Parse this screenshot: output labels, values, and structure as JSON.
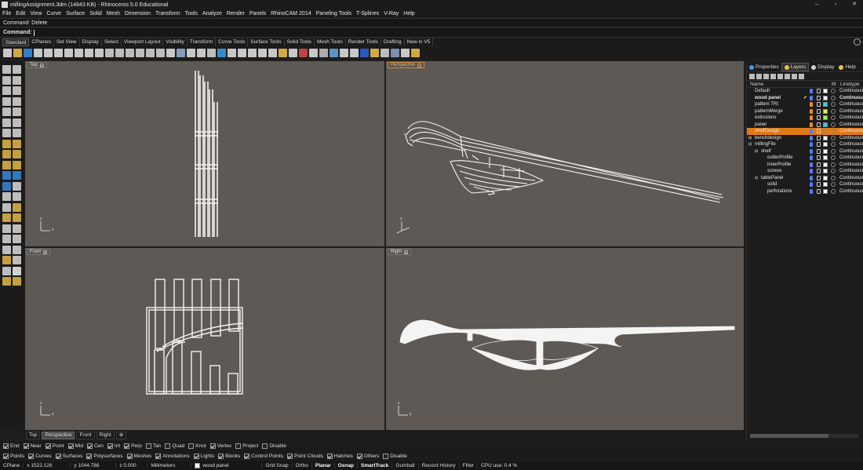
{
  "window": {
    "title": "millingAssignment.3dm (14843 KB) - Rhinoceros 5.0 Educational",
    "minimize": "–",
    "maximize": "▫",
    "close": "✕"
  },
  "menu": [
    "File",
    "Edit",
    "View",
    "Curve",
    "Surface",
    "Solid",
    "Mesh",
    "Dimension",
    "Transform",
    "Tools",
    "Analyze",
    "Render",
    "Panels",
    "RhinoCAM 2014",
    "Paneling Tools",
    "T-Splines",
    "V-Ray",
    "Help"
  ],
  "command": {
    "history": "Command: Delete",
    "prompt": "Command:"
  },
  "toolbar_tabs": [
    "Standard",
    "CPlanes",
    "Set View",
    "Display",
    "Select",
    "Viewport Layout",
    "Visibility",
    "Transform",
    "Curve Tools",
    "Surface Tools",
    "Solid Tools",
    "Mesh Tools",
    "Render Tools",
    "Drafting",
    "New in V5"
  ],
  "toolbar_tab_active": "Standard",
  "colors": {
    "viewport_bg": "#5e5954",
    "accent": "#e07a16",
    "active_viewport_label": "#f3b26a"
  },
  "viewports": {
    "top": {
      "label": "Top"
    },
    "perspective": {
      "label": "Perspective"
    },
    "front": {
      "label": "Front"
    },
    "right": {
      "label": "Right"
    }
  },
  "axes": {
    "x": "x",
    "y": "y",
    "z": "z"
  },
  "viewport_tabs": [
    "Top",
    "Perspective",
    "Front",
    "Right"
  ],
  "viewport_tab_active": "Perspective",
  "viewport_tab_add": "⊕",
  "panel": {
    "tabs": [
      {
        "label": "Properties",
        "icon": "properties-icon"
      },
      {
        "label": "Layers",
        "icon": "layers-icon"
      },
      {
        "label": "Display",
        "icon": "display-icon"
      },
      {
        "label": "Help",
        "icon": "help-icon"
      }
    ],
    "active_tab": "Layers",
    "columns": {
      "name": "Name",
      "material": "M",
      "linetype": "Linetype"
    },
    "layers": [
      {
        "name": "Default",
        "indent": 0,
        "color": "#ffffff",
        "linetype": "Continuous",
        "bulb": "#5b7bff",
        "current": false,
        "selected": false
      },
      {
        "name": "wood panel",
        "indent": 0,
        "color": "#ffffff",
        "linetype": "Continuous",
        "bulb": "#5b7bff",
        "current": true,
        "selected": false,
        "bold": true
      },
      {
        "name": "pattern TRI",
        "indent": 0,
        "color": "#22d3ee",
        "linetype": "Continuous",
        "bulb": "#ff8c1a",
        "current": false,
        "selected": false
      },
      {
        "name": "patternMerge",
        "indent": 0,
        "color": "#f5ec4a",
        "linetype": "Continuous",
        "bulb": "#ff8c1a",
        "current": false,
        "selected": false
      },
      {
        "name": "extrusions",
        "indent": 0,
        "color": "#9ef04b",
        "linetype": "Continuous",
        "bulb": "#ff8c1a",
        "current": false,
        "selected": false
      },
      {
        "name": "panel",
        "indent": 0,
        "color": "#22d3ee",
        "linetype": "Continuous",
        "bulb": "#ff8c1a",
        "current": false,
        "selected": false
      },
      {
        "name": "shelfDesign",
        "indent": 0,
        "color": "#e07a16",
        "linetype": "Continuous",
        "bulb": "#5b7bff",
        "current": false,
        "selected": true
      },
      {
        "name": "benchdesign",
        "indent": 0,
        "color": "#ffffff",
        "linetype": "Continuous",
        "bulb": "#5b7bff",
        "current": false,
        "selected": false,
        "expander": "⊞"
      },
      {
        "name": "millingFile",
        "indent": 0,
        "color": "#ffffff",
        "linetype": "Continuous",
        "bulb": "#5b7bff",
        "current": false,
        "selected": false,
        "expander": "⊟"
      },
      {
        "name": "shelf",
        "indent": 1,
        "color": "#ffffff",
        "linetype": "Continuous",
        "bulb": "#5b7bff",
        "current": false,
        "selected": false,
        "expander": "⊟"
      },
      {
        "name": "outterProfile",
        "indent": 2,
        "color": "#ffffff",
        "linetype": "Continuous",
        "bulb": "#5b7bff",
        "current": false,
        "selected": false
      },
      {
        "name": "innerProfile",
        "indent": 2,
        "color": "#ffffff",
        "linetype": "Continuous",
        "bulb": "#5b7bff",
        "current": false,
        "selected": false
      },
      {
        "name": "screws",
        "indent": 2,
        "color": "#ffffff",
        "linetype": "Continuous",
        "bulb": "#5b7bff",
        "current": false,
        "selected": false
      },
      {
        "name": "tablePanel",
        "indent": 1,
        "color": "#ffffff",
        "linetype": "Continuous",
        "bulb": "#5b7bff",
        "current": false,
        "selected": false,
        "expander": "⊟"
      },
      {
        "name": "solid",
        "indent": 2,
        "color": "#ffffff",
        "linetype": "Continuous",
        "bulb": "#5b7bff",
        "current": false,
        "selected": false
      },
      {
        "name": "perforations",
        "indent": 2,
        "color": "#ffffff",
        "linetype": "Continuous",
        "bulb": "#5b7bff",
        "current": false,
        "selected": false
      }
    ]
  },
  "osnaps": {
    "row1": [
      {
        "label": "End",
        "checked": true
      },
      {
        "label": "Near",
        "checked": true
      },
      {
        "label": "Point",
        "checked": true
      },
      {
        "label": "Mid",
        "checked": true
      },
      {
        "label": "Cen",
        "checked": true
      },
      {
        "label": "Int",
        "checked": true
      },
      {
        "label": "Perp",
        "checked": true
      },
      {
        "label": "Tan",
        "checked": false
      },
      {
        "label": "Quad",
        "checked": false
      },
      {
        "label": "Knot",
        "checked": false
      },
      {
        "label": "Vertex",
        "checked": true
      },
      {
        "label": "Project",
        "checked": false
      },
      {
        "label": "Disable",
        "checked": false
      }
    ],
    "row2": [
      {
        "label": "Points",
        "checked": true
      },
      {
        "label": "Curves",
        "checked": true
      },
      {
        "label": "Surfaces",
        "checked": true
      },
      {
        "label": "Polysurfaces",
        "checked": true
      },
      {
        "label": "Meshes",
        "checked": true
      },
      {
        "label": "Annotations",
        "checked": true
      },
      {
        "label": "Lights",
        "checked": true
      },
      {
        "label": "Blocks",
        "checked": true
      },
      {
        "label": "Control Points",
        "checked": true
      },
      {
        "label": "Point Clouds",
        "checked": true
      },
      {
        "label": "Hatches",
        "checked": true
      },
      {
        "label": "Others",
        "checked": true
      },
      {
        "label": "Disable",
        "checked": false
      }
    ]
  },
  "status": {
    "cplane": "CPlane",
    "x": "x 1522.126",
    "y": "y 1044.788",
    "z": "z 0.000",
    "units": "Millimeters",
    "layer": "wood panel",
    "layer_color": "#ffffff",
    "grid_snap": "Grid Snap",
    "ortho": "Ortho",
    "planar": "Planar",
    "osnap": "Osnap",
    "smarttrack": "SmartTrack",
    "gumball": "Gumball",
    "record_history": "Record History",
    "filter": "Filter",
    "cpu": "CPU use: 0.4 %"
  }
}
